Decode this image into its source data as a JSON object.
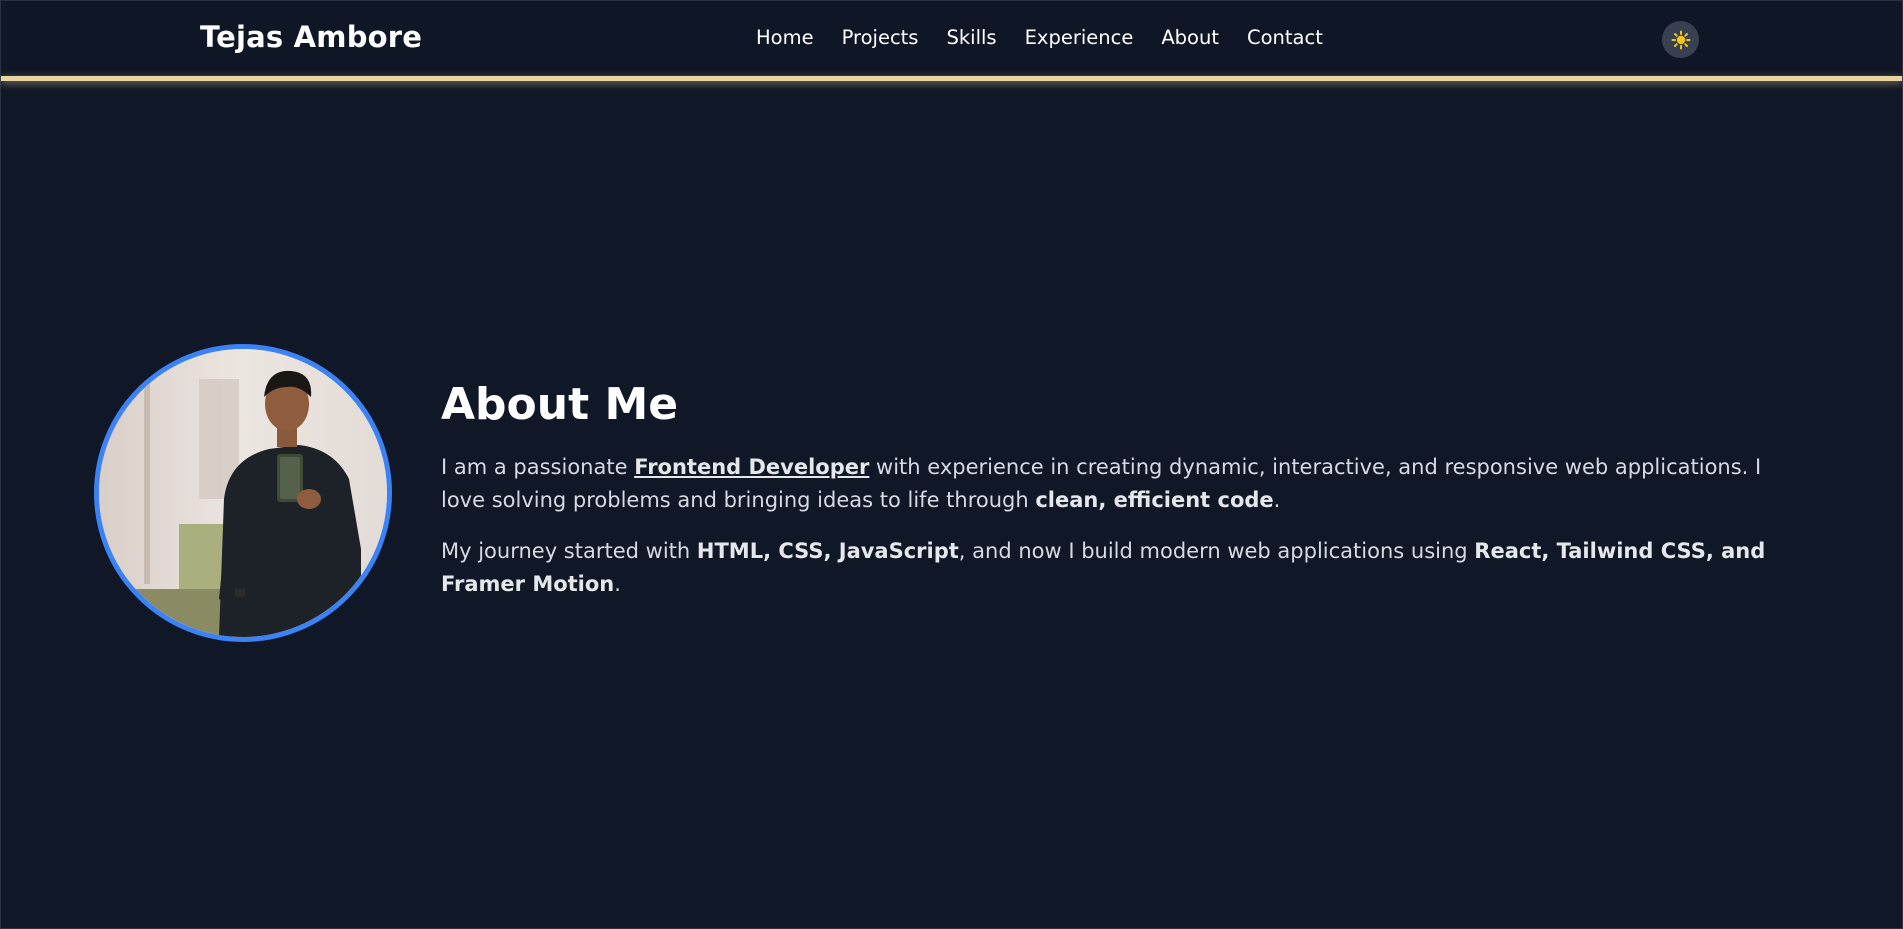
{
  "header": {
    "brand": "Tejas Ambore",
    "nav": [
      "Home",
      "Projects",
      "Skills",
      "Experience",
      "About",
      "Contact"
    ],
    "theme_toggle_icon": "sun-icon",
    "accent_glow_color": "#e7d6a1"
  },
  "about": {
    "title": "About Me",
    "p1": {
      "t1": "I am a passionate ",
      "role": "Frontend Developer",
      "t2": " with experience in creating dynamic, interactive, and responsive web applications. I love solving problems and bringing ideas to life through ",
      "b1": "clean, efficient code",
      "t3": "."
    },
    "p2": {
      "t1": "My journey started with ",
      "b1": "HTML, CSS, JavaScript",
      "t2": ", and now I build modern web applications using ",
      "b2": "React, Tailwind CSS, and Framer Motion",
      "t3": "."
    },
    "avatar_border_color": "#3b82f6"
  },
  "colors": {
    "background": "#101827",
    "text": "#ffffff",
    "muted_text": "#d6dae3"
  }
}
